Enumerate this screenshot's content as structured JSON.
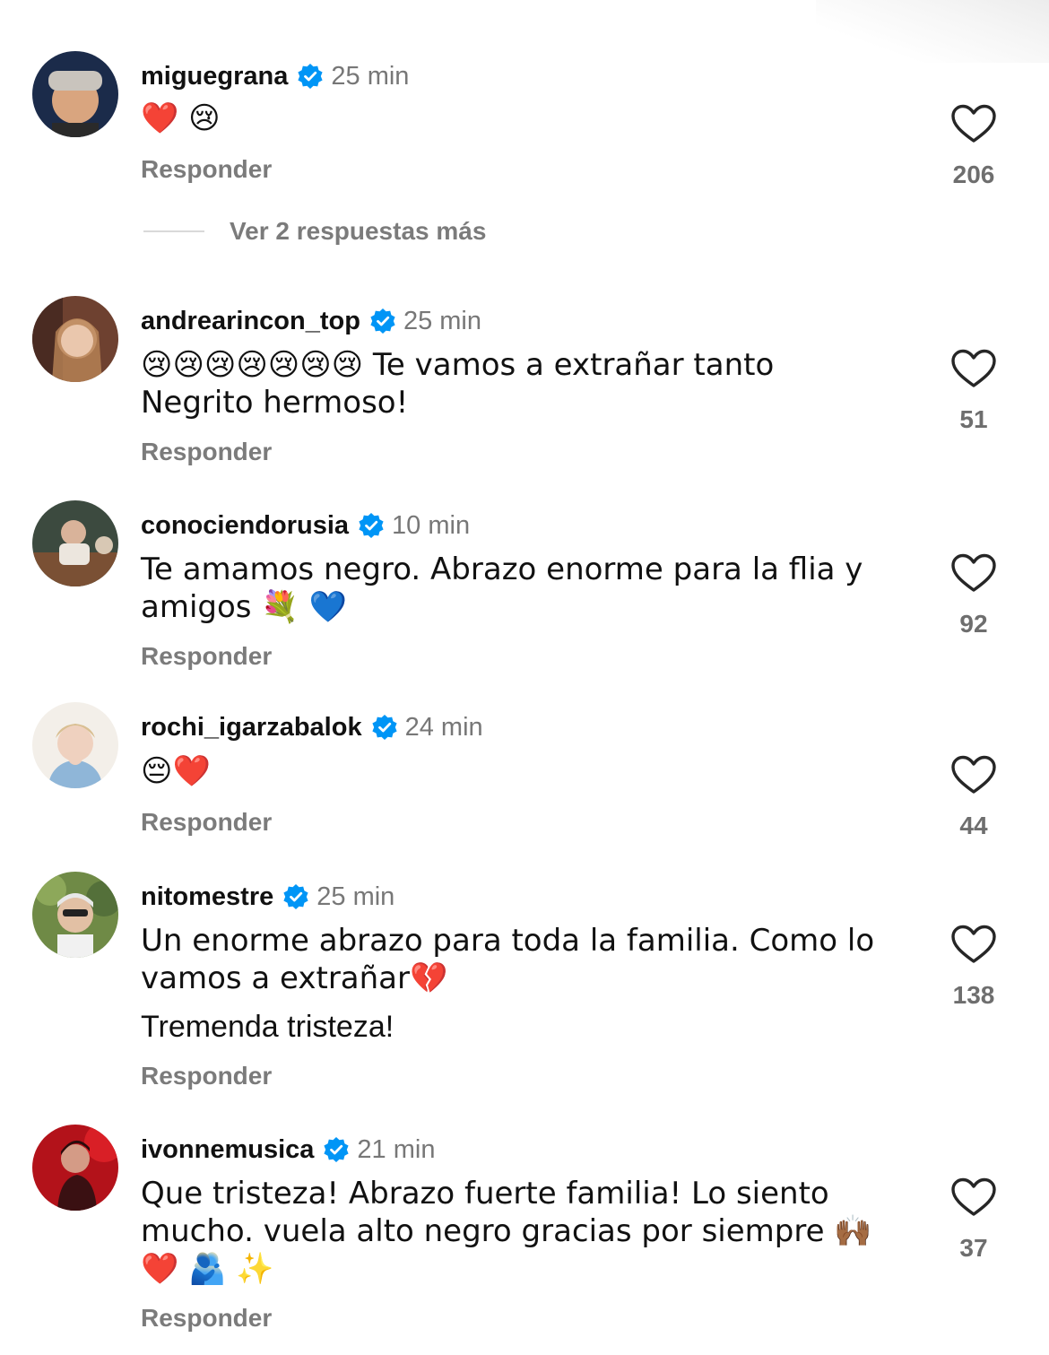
{
  "comments": [
    {
      "username": "miguegrana",
      "time": "25 min",
      "lines": [
        "❤️ 😢"
      ],
      "reply": "Responder",
      "likes": "206"
    },
    {
      "username": "andrearincon_top",
      "time": "25 min",
      "lines": [
        "😢😢😢😢😢😢😢 Te vamos a extrañar tanto Negrito hermoso!"
      ],
      "reply": "Responder",
      "likes": "51"
    },
    {
      "username": "conociendorusia",
      "time": "10 min",
      "lines": [
        "Te amamos negro. Abrazo enorme para la flia y amigos 💐 💙"
      ],
      "reply": "Responder",
      "likes": "92"
    },
    {
      "username": "rochi_igarzabalok",
      "time": "24 min",
      "lines": [
        "😔❤️"
      ],
      "reply": "Responder",
      "likes": "44"
    },
    {
      "username": "nitomestre",
      "time": "25 min",
      "lines": [
        "Un enorme abrazo para toda la familia. Como lo vamos a extrañar💔",
        "Tremenda tristeza!"
      ],
      "reply": "Responder",
      "likes": "138"
    },
    {
      "username": "ivonnemusica",
      "time": "21 min",
      "lines": [
        "Que tristeza! Abrazo fuerte familia! Lo siento mucho. vuela alto negro gracias por siempre 🙌🏾 ❤️ 🫂 ✨"
      ],
      "reply": "Responder",
      "likes": "37"
    }
  ],
  "view_more_replies": "Ver 2 respuestas más",
  "icons": {
    "verified": "verified-badge-icon",
    "like": "heart-outline-icon"
  },
  "colors": {
    "verified": "#0095f6",
    "secondary_text": "#7b7b7b"
  }
}
